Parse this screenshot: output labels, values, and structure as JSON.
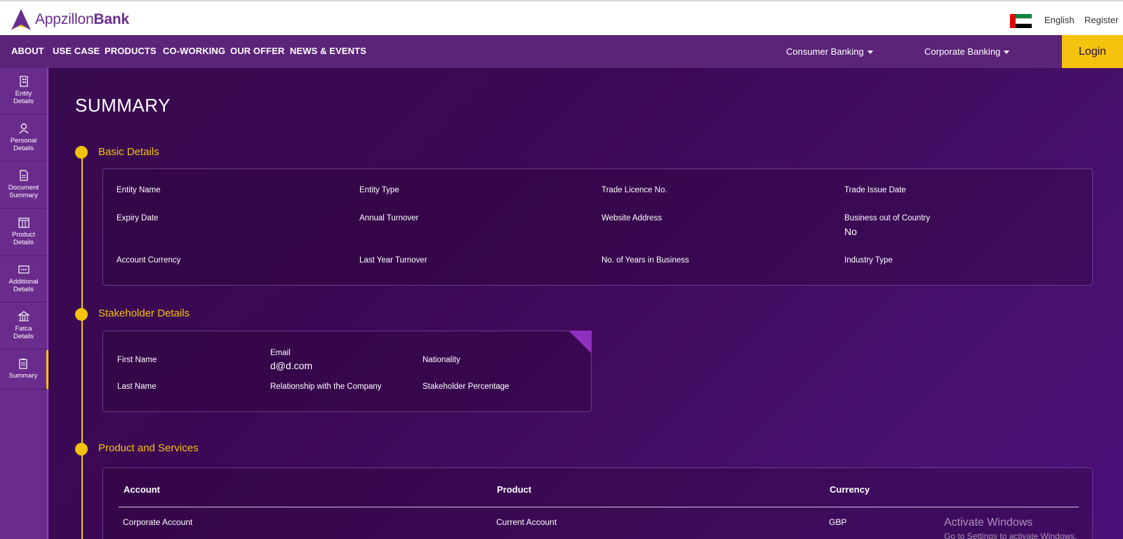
{
  "header": {
    "logo_name": "Appzillon",
    "logo_bold": "Bank",
    "language": "English",
    "register": "Register",
    "flag_icon": "uae-flag-icon"
  },
  "nav": {
    "items": [
      "ABOUT",
      "USE CASE",
      "PRODUCTS",
      "CO-WORKING",
      "OUR OFFER",
      "NEWS & EVENTS"
    ],
    "consumer": "Consumer Banking",
    "corporate": "Corporate Banking",
    "login": "Login"
  },
  "sidebar": {
    "items": [
      {
        "label": "Entity\nDetails",
        "icon": "building-icon"
      },
      {
        "label": "Personal\nDetails",
        "icon": "person-icon"
      },
      {
        "label": "Document\nSummary",
        "icon": "document-icon"
      },
      {
        "label": "Product\nDetails",
        "icon": "product-icon"
      },
      {
        "label": "Additional\nDetails",
        "icon": "additional-icon"
      },
      {
        "label": "Fatca\nDetails",
        "icon": "bank-icon"
      },
      {
        "label": "Summary",
        "icon": "clipboard-icon"
      }
    ]
  },
  "page": {
    "title": "SUMMARY"
  },
  "basic": {
    "title": "Basic Details",
    "entity_name": "Entity Name",
    "entity_type": "Entity Type",
    "trade_licence": "Trade Licence No.",
    "trade_issue_date": "Trade Issue Date",
    "expiry_date": "Expiry Date",
    "annual_turnover": "Annual Turnover",
    "website": "Website Address",
    "business_out": "Business out of Country",
    "business_out_value": "No",
    "account_currency": "Account Currency",
    "last_year_turnover": "Last Year Turnover",
    "years_in_business": "No. of Years in Business",
    "industry_type": "Industry Type"
  },
  "stakeholder": {
    "title": "Stakeholder Details",
    "first_name": "First Name",
    "email": "Email",
    "email_value": "d@d.com",
    "nationality": "Nationality",
    "last_name": "Last Name",
    "relationship": "Relationship with the Company",
    "percentage": "Stakeholder Percentage"
  },
  "products": {
    "title": "Product and Services",
    "headers": [
      "Account",
      "Product",
      "Currency"
    ],
    "rows": [
      [
        "Corporate Account",
        "Current Account",
        "GBP"
      ]
    ]
  },
  "watermark": {
    "line1": "Activate Windows",
    "line2": "Go to Settings to activate Windows."
  },
  "colors": {
    "brand_purple": "#6b2c91",
    "accent_yellow": "#f5c30d",
    "nav_purple": "#5b2478"
  }
}
